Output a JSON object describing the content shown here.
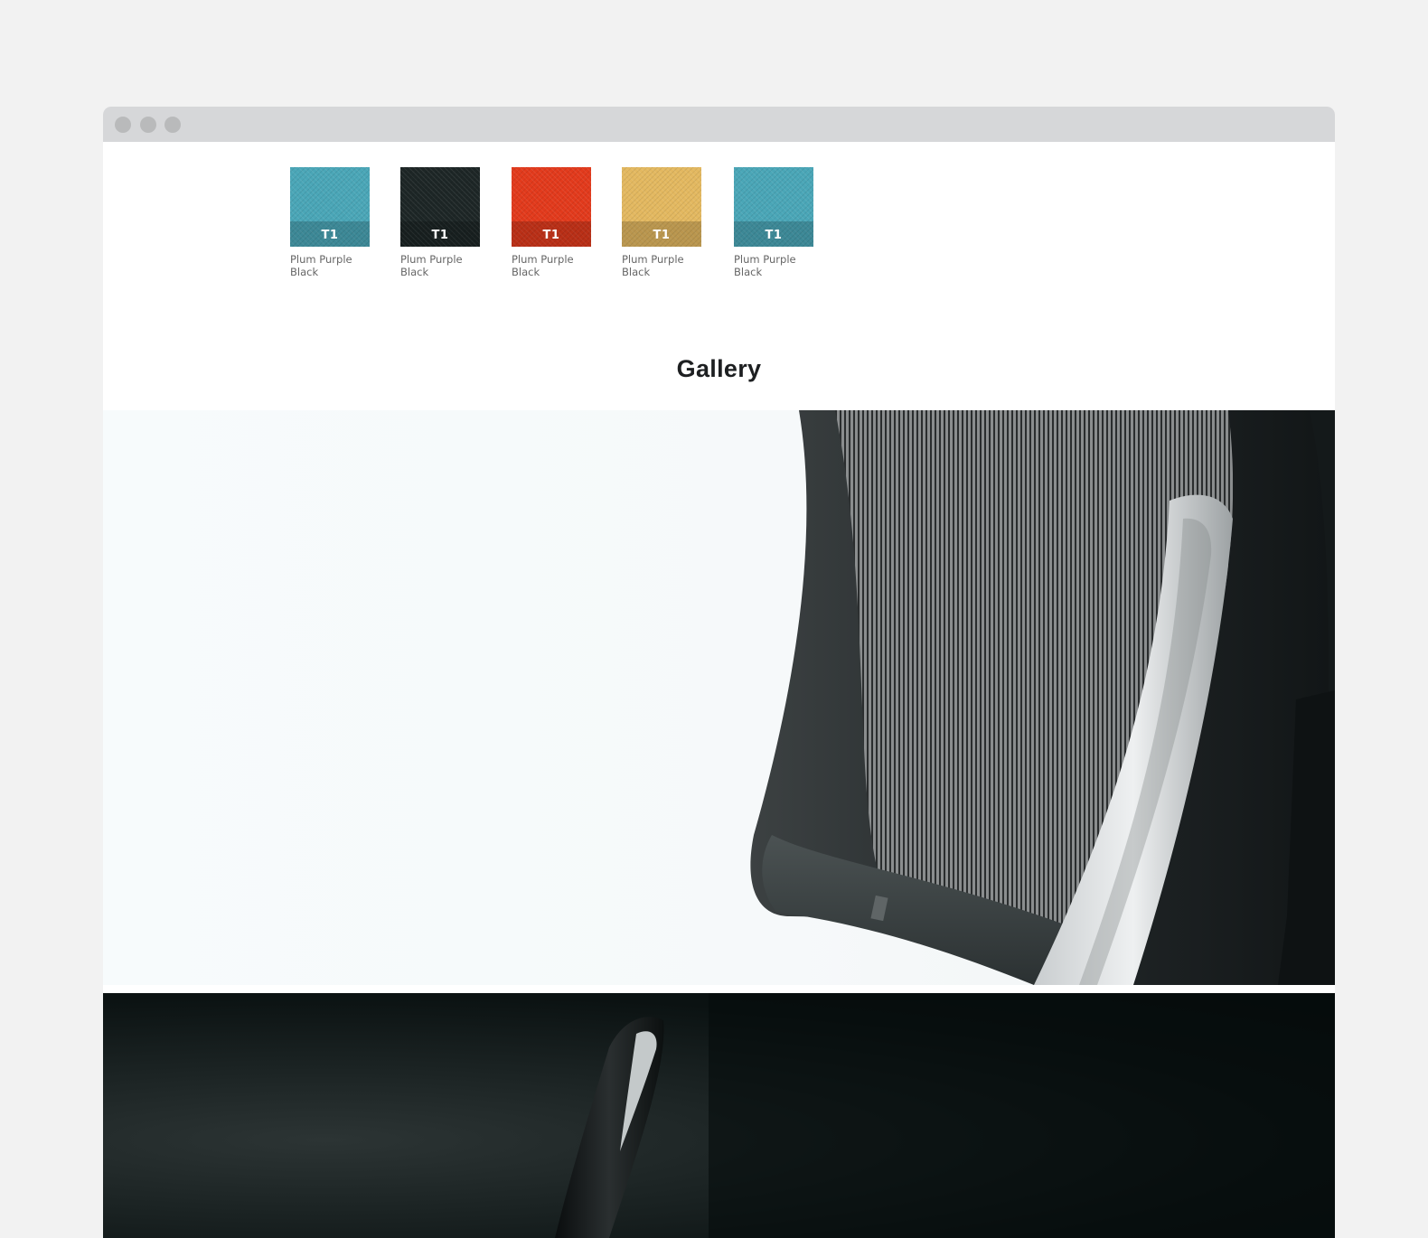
{
  "window": {
    "controls": [
      "close",
      "minimize",
      "maximize"
    ]
  },
  "swatches": [
    {
      "code": "T1",
      "name_line1": "Plum Purple",
      "name_line2": "Black",
      "color": "#4aa6b7"
    },
    {
      "code": "T1",
      "name_line1": "Plum Purple",
      "name_line2": "Black",
      "color": "#1d2626"
    },
    {
      "code": "T1",
      "name_line1": "Plum Purple",
      "name_line2": "Black",
      "color": "#e23a1c"
    },
    {
      "code": "T1",
      "name_line1": "Plum Purple",
      "name_line2": "Black",
      "color": "#e3b860"
    },
    {
      "code": "T1",
      "name_line1": "Plum Purple",
      "name_line2": "Black",
      "color": "#4aa6b7"
    }
  ],
  "gallery": {
    "title": "Gallery",
    "images": [
      {
        "subject": "mesh office chair backrest, close-up"
      },
      {
        "subject": "black office chair armrest on dark background"
      }
    ]
  }
}
